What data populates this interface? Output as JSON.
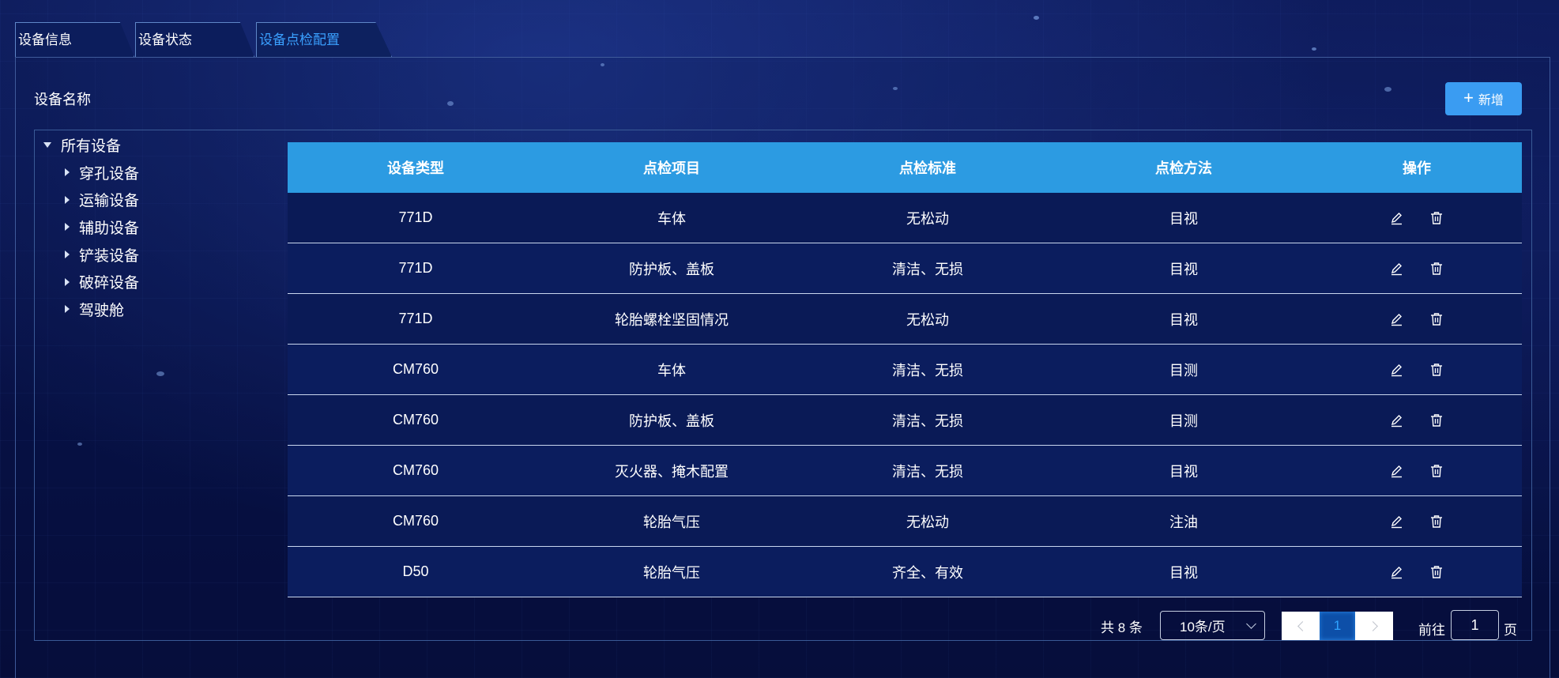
{
  "tabs": [
    {
      "label": "设备信息"
    },
    {
      "label": "设备状态"
    },
    {
      "label": "设备点检配置"
    }
  ],
  "panel": {
    "title": "设备名称",
    "add_button_label": "新增"
  },
  "tree": {
    "root": "所有设备",
    "children": [
      "穿孔设备",
      "运输设备",
      "辅助设备",
      "铲装设备",
      "破碎设备",
      "驾驶舱"
    ]
  },
  "table": {
    "columns": [
      "设备类型",
      "点检项目",
      "点检标准",
      "点检方法",
      "操作"
    ],
    "rows": [
      [
        "771D",
        "车体",
        "无松动",
        "目视"
      ],
      [
        "771D",
        "防护板、盖板",
        "清洁、无损",
        "目视"
      ],
      [
        "771D",
        "轮胎螺栓坚固情况",
        "无松动",
        "目视"
      ],
      [
        "CM760",
        "车体",
        "清洁、无损",
        "目测"
      ],
      [
        "CM760",
        "防护板、盖板",
        "清洁、无损",
        "目测"
      ],
      [
        "CM760",
        "灭火器、掩木配置",
        "清洁、无损",
        "目视"
      ],
      [
        "CM760",
        "轮胎气压",
        "无松动",
        "注油"
      ],
      [
        "D50",
        "轮胎气压",
        "齐全、有效",
        "目视"
      ]
    ],
    "row_actions": [
      "edit-icon",
      "delete-icon"
    ]
  },
  "pagination": {
    "total_text": "共 8 条",
    "page_size": "10条/页",
    "current_page": "1",
    "goto_label": "前往",
    "goto_value": "1",
    "goto_suffix": "页"
  },
  "colors": {
    "accent": "#3a9cf2",
    "header": "#2c9be2",
    "active_tab": "#3aa0ff"
  }
}
